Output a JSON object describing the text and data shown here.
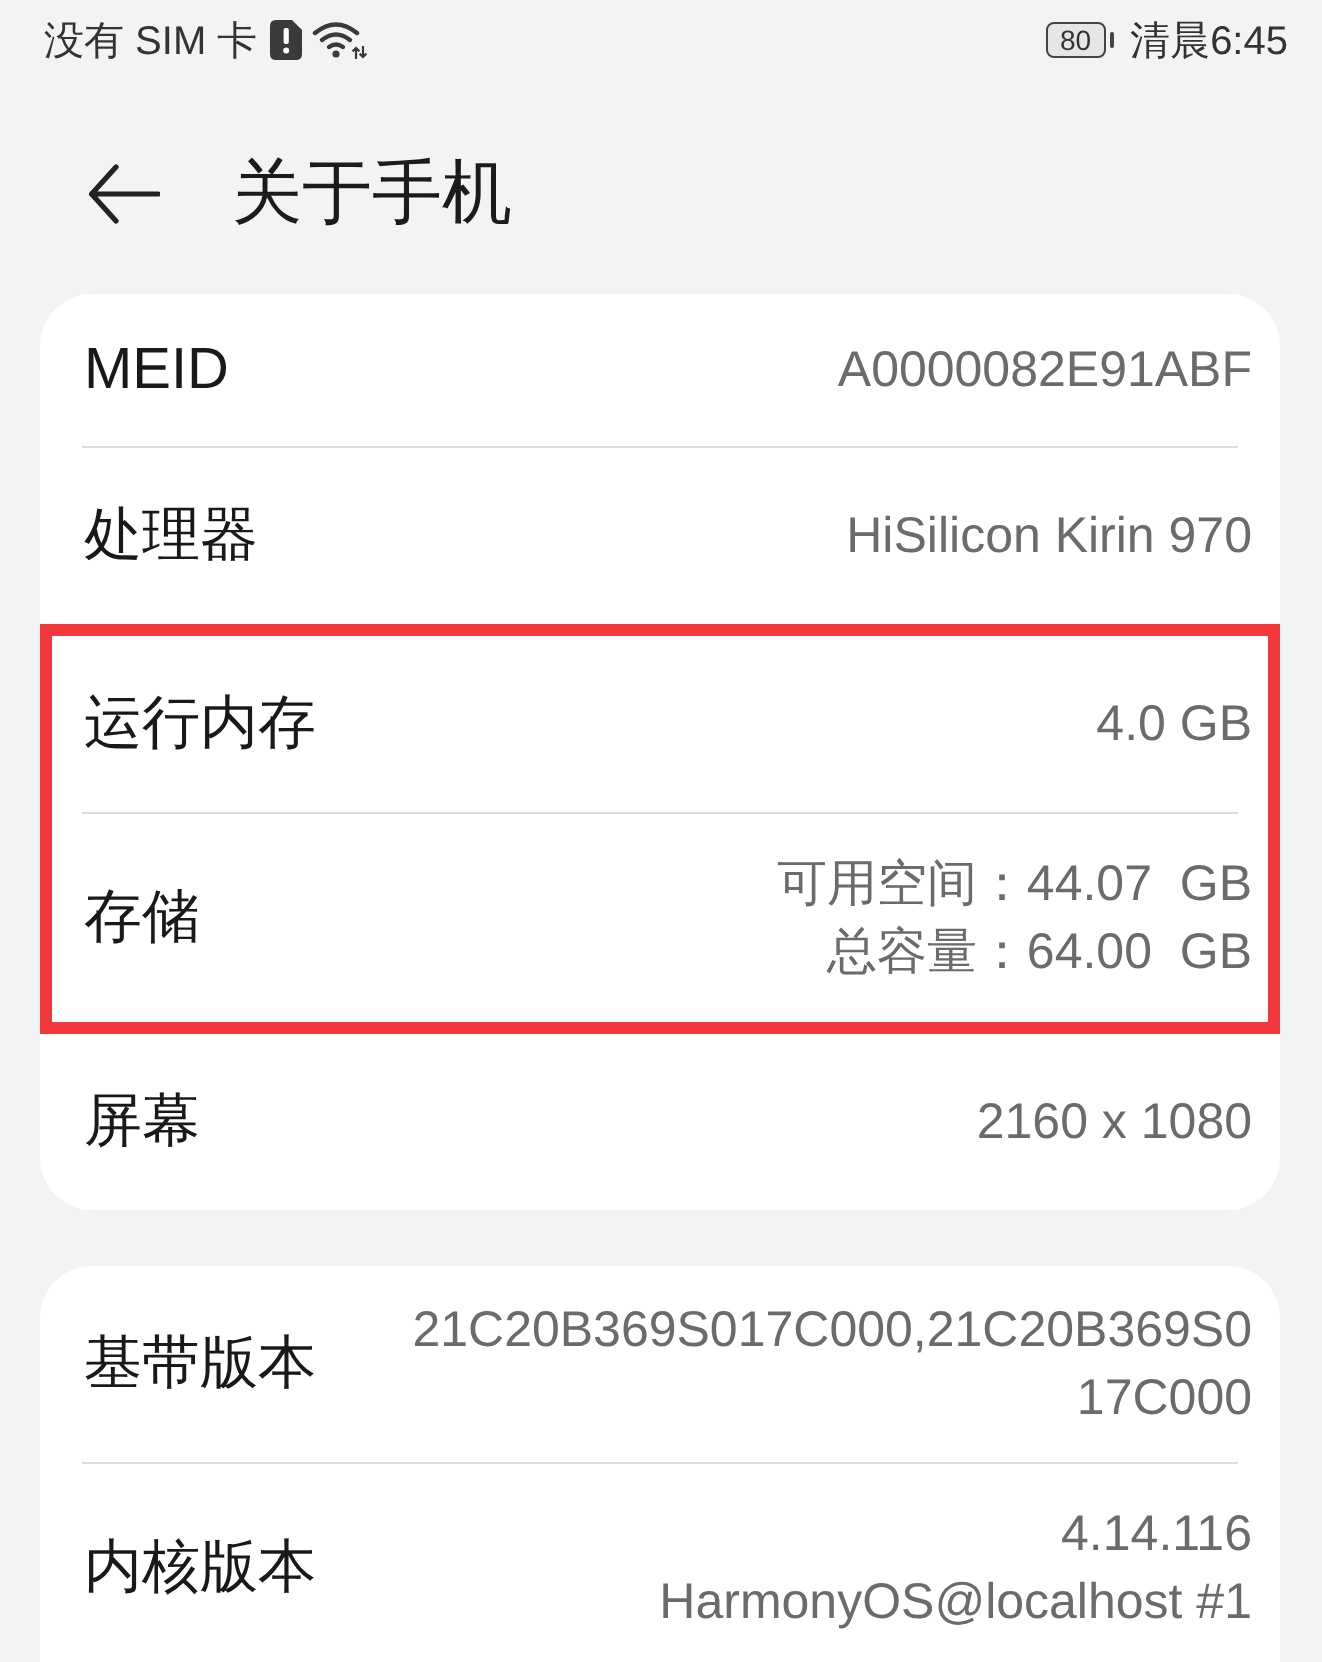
{
  "status_bar": {
    "carrier": "没有 SIM 卡",
    "battery": "80",
    "time": "清晨6:45"
  },
  "header": {
    "title": "关于手机"
  },
  "cards": [
    {
      "rows": [
        {
          "label": "MEID",
          "lines": [
            "A0000082E91ABF"
          ],
          "highlighted": false
        },
        {
          "label": "处理器",
          "lines": [
            "HiSilicon Kirin 970"
          ],
          "highlighted": false
        },
        {
          "label": "运行内存",
          "lines": [
            "4.0 GB"
          ],
          "highlighted": true
        },
        {
          "label": "存储",
          "lines": [
            "可用空间：44.07  GB",
            "总容量：64.00  GB"
          ],
          "highlighted": true
        },
        {
          "label": "屏幕",
          "lines": [
            "2160 x 1080"
          ],
          "highlighted": false
        }
      ]
    },
    {
      "rows": [
        {
          "label": "基带版本",
          "lines": [
            "21C20B369S017C000,21C20B369S017C000"
          ],
          "highlighted": false
        },
        {
          "label": "内核版本",
          "lines": [
            "4.14.116",
            "HarmonyOS@localhost #1"
          ],
          "highlighted": false
        }
      ]
    }
  ]
}
